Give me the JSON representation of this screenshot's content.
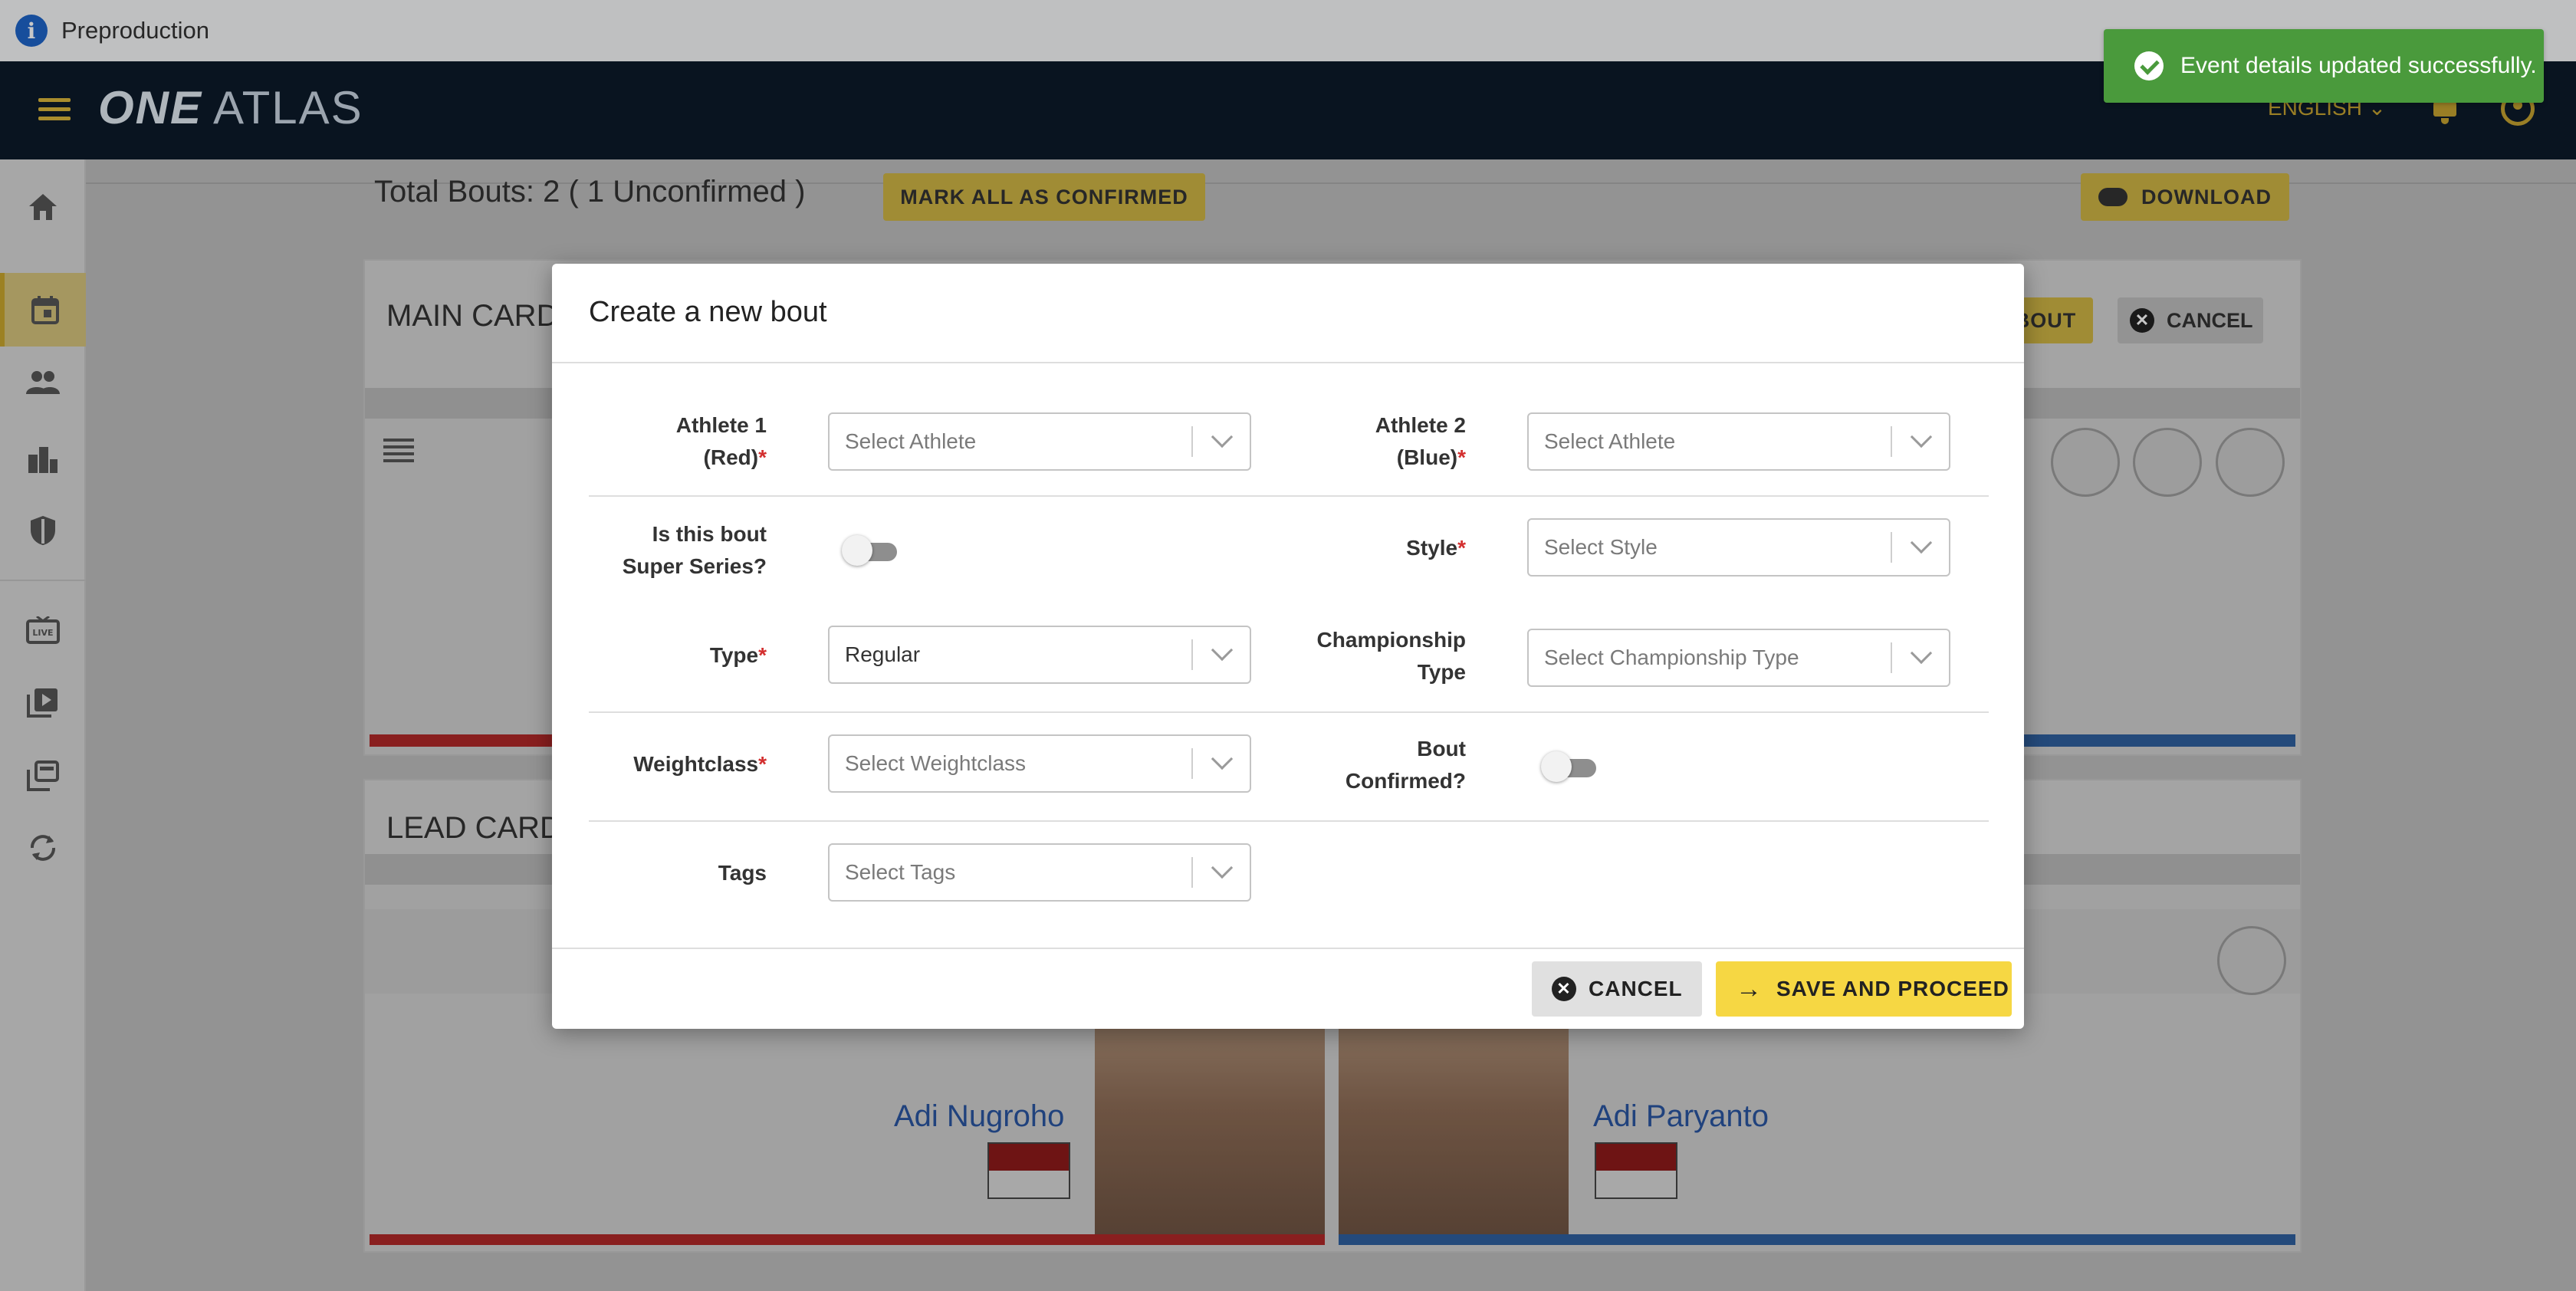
{
  "env": {
    "title": "Preproduction"
  },
  "header": {
    "logo_bold": "ONE",
    "logo_text": "ATLAS",
    "language": "ENGLISH ⌄"
  },
  "toast": {
    "message": "Event details updated successfully."
  },
  "background": {
    "total_bouts": "Total Bouts: 2 ( 1 Unconfirmed )",
    "mark_all": "MARK ALL AS CONFIRMED",
    "download": "DOWNLOAD",
    "main_card": "MAIN CARD",
    "lead_card": "LEAD CARD",
    "add_bout": "BOUT",
    "cancel": "CANCEL",
    "fighter1": "Adi Nugroho",
    "fighter2": "Adi Paryanto"
  },
  "modal": {
    "title": "Create a new bout",
    "fields": {
      "athlete1_label_l1": "Athlete 1",
      "athlete1_label_l2": "(Red)",
      "athlete1_placeholder": "Select Athlete",
      "athlete2_label_l1": "Athlete 2",
      "athlete2_label_l2": "(Blue)",
      "athlete2_placeholder": "Select Athlete",
      "super_series_l1": "Is this bout",
      "super_series_l2": "Super Series?",
      "style_label": "Style",
      "style_placeholder": "Select Style",
      "type_label": "Type",
      "type_value": "Regular",
      "championship_l1": "Championship",
      "championship_l2": "Type",
      "championship_placeholder": "Select Championship Type",
      "weightclass_label": "Weightclass",
      "weightclass_placeholder": "Select Weightclass",
      "confirmed_l1": "Bout",
      "confirmed_l2": "Confirmed?",
      "tags_label": "Tags",
      "tags_placeholder": "Select Tags",
      "required_mark": "*"
    },
    "buttons": {
      "cancel": "CANCEL",
      "save": "SAVE AND PROCEED"
    }
  }
}
